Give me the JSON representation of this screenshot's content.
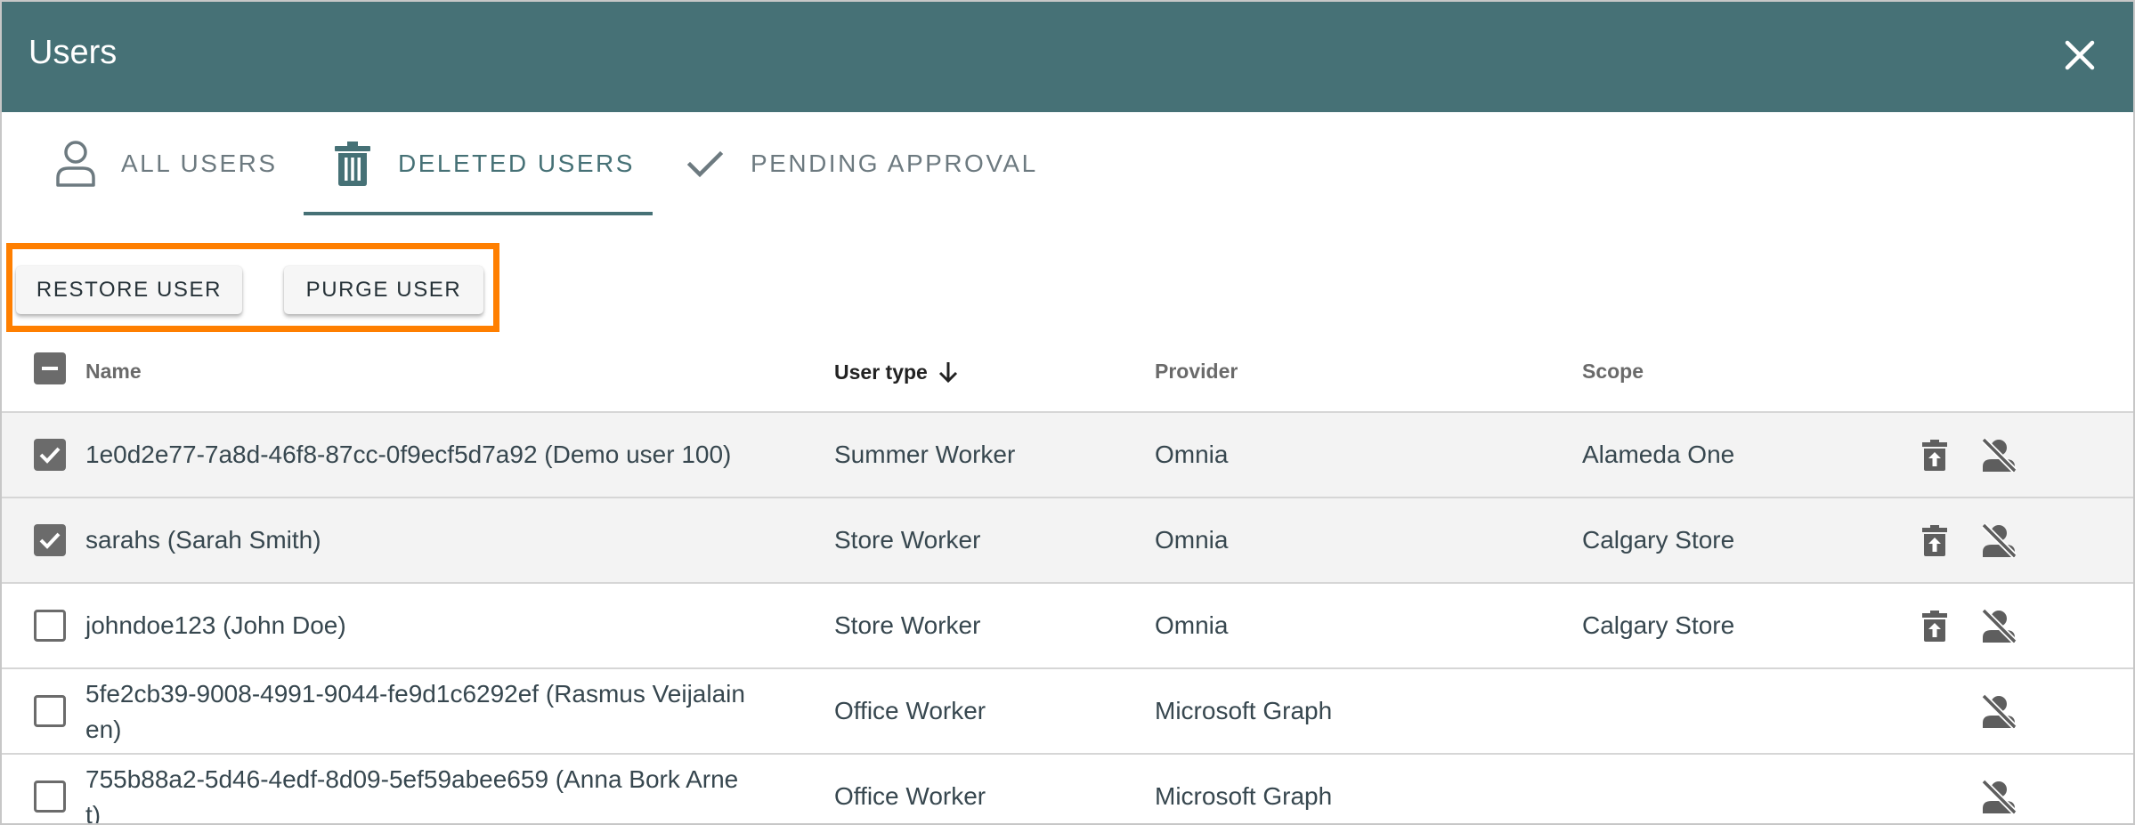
{
  "window": {
    "title": "Users"
  },
  "tabs": [
    {
      "label": "ALL USERS",
      "icon": "person-outline-icon",
      "active": false
    },
    {
      "label": "DELETED USERS",
      "icon": "trash-icon",
      "active": true
    },
    {
      "label": "PENDING APPROVAL",
      "icon": "checkmark-icon",
      "active": false
    }
  ],
  "actions": {
    "restore_label": "RESTORE USER",
    "purge_label": "PURGE USER"
  },
  "table": {
    "columns": {
      "name": "Name",
      "user_type": "User type",
      "provider": "Provider",
      "scope": "Scope"
    },
    "sort": {
      "column": "User type",
      "direction": "descending"
    },
    "select_all_state": "indeterminate",
    "rows": [
      {
        "name_line1": "1e0d2e77-7a8d-46f8-87cc-0f9ecf5d7a92 (Demo user 100)",
        "name_line2": "",
        "user_type": "Summer Worker",
        "provider": "Omnia",
        "scope": "Alameda One",
        "checked": true,
        "restorable": true
      },
      {
        "name_line1": "sarahs (Sarah Smith)",
        "name_line2": "",
        "user_type": "Store Worker",
        "provider": "Omnia",
        "scope": "Calgary Store",
        "checked": true,
        "restorable": true
      },
      {
        "name_line1": "johndoe123 (John Doe)",
        "name_line2": "",
        "user_type": "Store Worker",
        "provider": "Omnia",
        "scope": "Calgary Store",
        "checked": false,
        "restorable": true
      },
      {
        "name_line1": "5fe2cb39-9008-4991-9044-fe9d1c6292ef (Rasmus Veijalain",
        "name_line2": "en)",
        "user_type": "Office Worker",
        "provider": "Microsoft Graph",
        "scope": "",
        "checked": false,
        "restorable": false
      },
      {
        "name_line1": "755b88a2-5d46-4edf-8d09-5ef59abee659 (Anna Bork Arne",
        "name_line2": "t)",
        "user_type": "Office Worker",
        "provider": "Microsoft Graph",
        "scope": "",
        "checked": false,
        "restorable": false
      }
    ]
  },
  "colors": {
    "header_bg": "#467176",
    "accent": "#467176",
    "highlight_border": "#ff7f00",
    "selected_row_bg": "#f3f3f3"
  }
}
